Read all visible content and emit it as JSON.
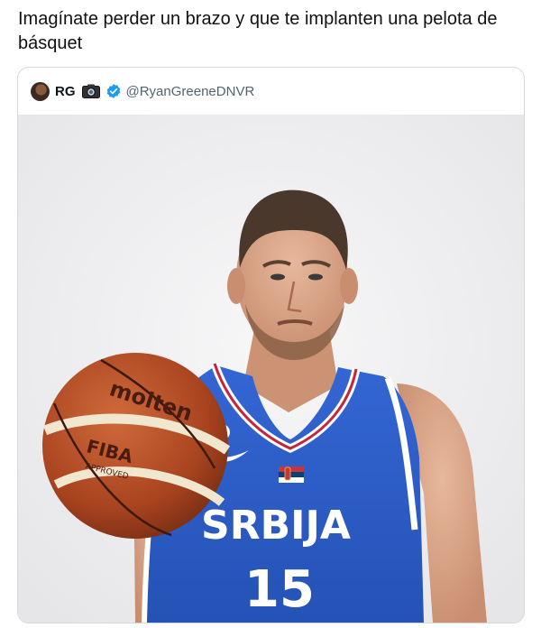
{
  "post": {
    "caption": "Imagínate perder un brazo y que te implanten una pelota de básquet"
  },
  "tweet": {
    "display_name": "RG",
    "handle": "@RyanGreeneDNVR",
    "icons": [
      "avatar",
      "camera-icon",
      "verified-badge-icon"
    ]
  },
  "photo": {
    "ball_brand": "molten",
    "ball_logo": "FIBA",
    "ball_approved": "APPROVED",
    "jersey_team": "SRBIJA",
    "jersey_number": "15",
    "colors": {
      "jersey_blue": "#2a5bc7",
      "jersey_trim": "#ffffff",
      "ball_orange": "#b5502a",
      "background": "#eeeef0",
      "verified_blue": "#1d9bf0"
    }
  }
}
